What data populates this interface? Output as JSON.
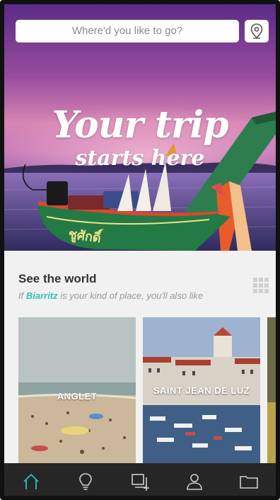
{
  "search": {
    "placeholder": "Where'd you like to go?"
  },
  "hero": {
    "line1": "Your trip",
    "line2": "starts here",
    "boat_text": "ชูศักดิ์"
  },
  "section": {
    "title": "See the world",
    "subtitle_prefix": "If ",
    "subtitle_city": "Biarritz",
    "subtitle_suffix": " is your kind of place, you'll also like"
  },
  "cards": [
    {
      "label": "ANGLET"
    },
    {
      "label": "SAINT JEAN DE LUZ"
    }
  ],
  "nav": {
    "items": [
      {
        "icon": "home-icon",
        "active": true
      },
      {
        "icon": "lightbulb-icon",
        "active": false
      },
      {
        "icon": "add-collection-icon",
        "active": false
      },
      {
        "icon": "profile-icon",
        "active": false
      },
      {
        "icon": "folder-icon",
        "active": false
      }
    ]
  },
  "colors": {
    "accent": "#2ec4b6",
    "nav_bg": "#262626",
    "section_bg": "#f1f1f1"
  }
}
